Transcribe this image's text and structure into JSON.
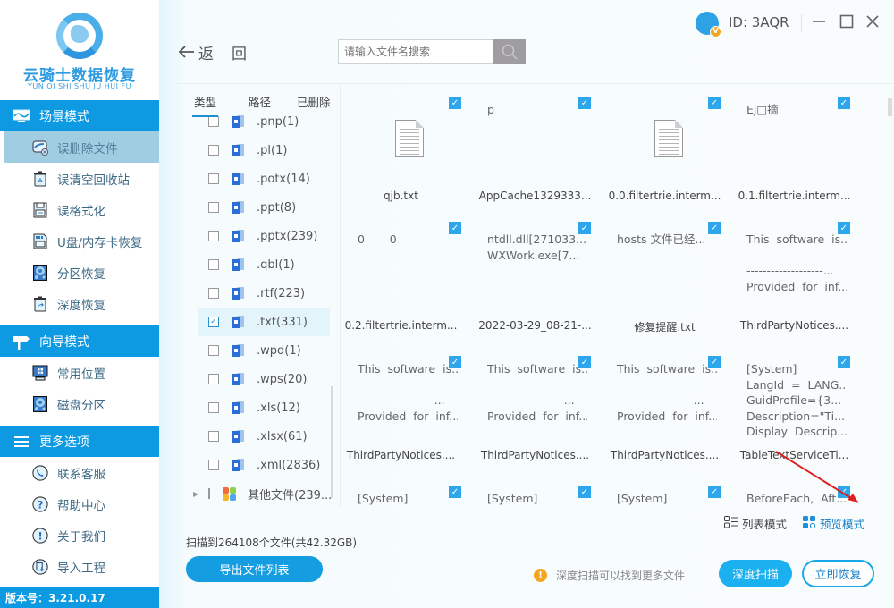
{
  "app": {
    "name": "云骑士数据恢复",
    "name_pinyin": "YUN QI SHI SHU JU HUI FU",
    "version": "版本号：3.21.0.17"
  },
  "titlebar": {
    "user_id": "ID: 3AQR",
    "avatar_badge": "V",
    "minimize_icon": "—",
    "maximize_icon": "☐",
    "close_icon": "✕"
  },
  "sidebar": {
    "sections": [
      {
        "label": "场景模式",
        "icon": "monitor-wave-icon",
        "items": [
          {
            "label": "误删除文件",
            "icon": "deleted-file-icon",
            "active": true
          },
          {
            "label": "误清空回收站",
            "icon": "recycle-bin-icon",
            "active": false
          },
          {
            "label": "误格式化",
            "icon": "floppy-icon",
            "active": false
          },
          {
            "label": "U盘/内存卡恢复",
            "icon": "sd-card-icon",
            "active": false
          },
          {
            "label": "分区恢复",
            "icon": "partition-icon",
            "active": false
          },
          {
            "label": "深度恢复",
            "icon": "deep-recover-icon",
            "active": false
          }
        ]
      },
      {
        "label": "向导模式",
        "icon": "signpost-icon",
        "items": [
          {
            "label": "常用位置",
            "icon": "windows-monitor-icon",
            "active": false
          },
          {
            "label": "磁盘分区",
            "icon": "disk-partition-icon",
            "active": false
          }
        ]
      },
      {
        "label": "更多选项",
        "icon": "menu-icon",
        "items": [
          {
            "label": "联系客服",
            "icon": "phone-icon",
            "active": false
          },
          {
            "label": "帮助中心",
            "icon": "help-icon",
            "active": false
          },
          {
            "label": "关于我们",
            "icon": "info-icon",
            "active": false
          },
          {
            "label": "导入工程",
            "icon": "import-icon",
            "active": false
          }
        ]
      }
    ]
  },
  "toolbar": {
    "back_label_1": "返",
    "back_label_2": "回",
    "search_placeholder": "请输入文件名搜索"
  },
  "filter": {
    "tabs": [
      {
        "label": "类型",
        "active": true
      },
      {
        "label": "路径",
        "active": false
      },
      {
        "label": "已删除",
        "active": false
      }
    ],
    "types": [
      {
        "label": ".pnp(1)",
        "checked": false
      },
      {
        "label": ".pl(1)",
        "checked": false
      },
      {
        "label": ".potx(14)",
        "checked": false
      },
      {
        "label": ".ppt(8)",
        "checked": false
      },
      {
        "label": ".pptx(239)",
        "checked": false
      },
      {
        "label": ".qbl(1)",
        "checked": false
      },
      {
        "label": ".rtf(223)",
        "checked": false
      },
      {
        "label": ".txt(331)",
        "checked": true
      },
      {
        "label": ".wpd(1)",
        "checked": false
      },
      {
        "label": ".wps(20)",
        "checked": false
      },
      {
        "label": ".xls(12)",
        "checked": false
      },
      {
        "label": ".xlsx(61)",
        "checked": false
      },
      {
        "label": ".xml(2836)",
        "checked": false
      },
      {
        "label": "其他文件(239...",
        "checked": false,
        "expandable": true
      }
    ]
  },
  "grid": {
    "items": [
      {
        "preview": "",
        "icon": true,
        "name": "qjb.txt",
        "checked": true
      },
      {
        "preview": "p",
        "icon": false,
        "name": "AppCache1329333...",
        "checked": true
      },
      {
        "preview": "",
        "icon": true,
        "name": "0.0.filtertrie.interm...",
        "checked": true
      },
      {
        "preview": "Ej□摘",
        "icon": false,
        "name": "0.1.filtertrie.interm...",
        "checked": true
      },
      {
        "preview": "0       0",
        "icon": false,
        "name": "0.2.filtertrie.interm...",
        "checked": true
      },
      {
        "preview": "ntdll.dll[271033...\nWXWork.exe[7...",
        "icon": false,
        "name": "2022-03-29_08-21-...",
        "checked": true
      },
      {
        "preview": "hosts 文件已经...",
        "icon": false,
        "name": "修复提醒.txt",
        "checked": true
      },
      {
        "preview": "This  software  is...\n\n-------------------...\nProvided  for  inf...",
        "icon": false,
        "name": "ThirdPartyNotices....",
        "checked": true
      },
      {
        "preview": "This  software  is...\n\n-------------------...\nProvided  for  inf...",
        "icon": false,
        "name": "ThirdPartyNotices....",
        "checked": true
      },
      {
        "preview": "This  software  is...\n\n-------------------...\nProvided  for  inf...",
        "icon": false,
        "name": "ThirdPartyNotices....",
        "checked": true
      },
      {
        "preview": "This  software  is...\n\n-------------------...\nProvided  for  inf...",
        "icon": false,
        "name": "ThirdPartyNotices....",
        "checked": true
      },
      {
        "preview": "[System]\nLangId  =  LANG...\nGuidProfile={3...\nDescription=\"Ti...\nDisplay  Descrip...",
        "icon": false,
        "name": "TableTextServiceTi...",
        "checked": true
      },
      {
        "preview": "[System]\nLangId = LANG...",
        "icon": false,
        "name": "",
        "checked": true
      },
      {
        "preview": "[System]\nLangId = LANG...",
        "icon": false,
        "name": "",
        "checked": true
      },
      {
        "preview": "[System]\nLangId = LANG...",
        "icon": false,
        "name": "",
        "checked": true
      },
      {
        "preview": "BeforeEach,  Aft...",
        "icon": false,
        "name": "",
        "checked": true
      }
    ]
  },
  "view_modes": {
    "list_label": "列表模式",
    "preview_label": "预览模式",
    "active": "preview"
  },
  "footer": {
    "scan_summary": "扫描到264108个文件(共42.32GB)",
    "export_label": "导出文件列表",
    "hint": "深度扫描可以找到更多文件",
    "deep_scan_label": "深度扫描",
    "recover_label": "立即恢复"
  },
  "colors": {
    "brand_blue": "#0d9ae3",
    "active_nav": "#a1cde3",
    "check_blue": "#2ea6ec",
    "warning": "#f4a622",
    "annotation_red": "#e02020"
  }
}
